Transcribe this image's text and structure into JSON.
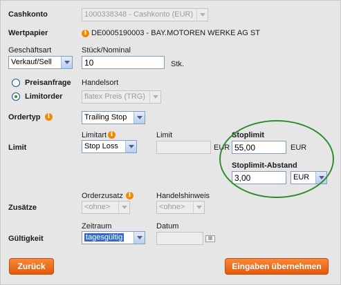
{
  "cashkonto": {
    "label": "Cashkonto",
    "value": "1000338348 - Cashkonto (EUR)"
  },
  "wertpapier": {
    "label": "Wertpapier",
    "value": "DE0005190003 - BAY.MOTOREN WERKE AG ST"
  },
  "geschaeftsart": {
    "label": "Geschäftsart",
    "value": "Verkauf/Sell"
  },
  "stueck": {
    "label": "Stück/Nominal",
    "value": "10",
    "unit": "Stk."
  },
  "preisanfrage": {
    "label": "Preisanfrage",
    "checked": false
  },
  "limitorder": {
    "label": "Limitorder",
    "checked": true
  },
  "handelsort": {
    "label": "Handelsort",
    "value": "flatex Preis (TRG)"
  },
  "ordertyp": {
    "label": "Ordertyp",
    "value": "Trailing Stop"
  },
  "limit": {
    "label": "Limit",
    "limitart_label": "Limitart",
    "limitart_value": "Stop Loss",
    "limit_label": "Limit",
    "limit_value": "",
    "limit_unit": "EUR",
    "stoplimit_label": "Stoplimit",
    "stoplimit_value": "55,00",
    "stoplimit_unit": "EUR",
    "abstand_label": "Stoplimit-Abstand",
    "abstand_value": "3,00",
    "abstand_unit": "EUR"
  },
  "zusaetze": {
    "label": "Zusätze",
    "orderzusatz_label": "Orderzusatz",
    "orderzusatz_value": "<ohne>",
    "handelshinweis_label": "Handelshinweis",
    "handelshinweis_value": "<ohne>"
  },
  "gueltigkeit": {
    "label": "Gültigkeit",
    "zeitraum_label": "Zeitraum",
    "zeitraum_value": "tagesgültig",
    "datum_label": "Datum",
    "datum_value": ""
  },
  "buttons": {
    "back": "Zurück",
    "submit": "Eingaben übernehmen"
  },
  "icons": {
    "info": "info-icon",
    "calendar": "calendar-icon"
  },
  "colors": {
    "accent": "#e8641a",
    "highlight_circle": "#2e8b2e",
    "selection": "#316ac5"
  }
}
